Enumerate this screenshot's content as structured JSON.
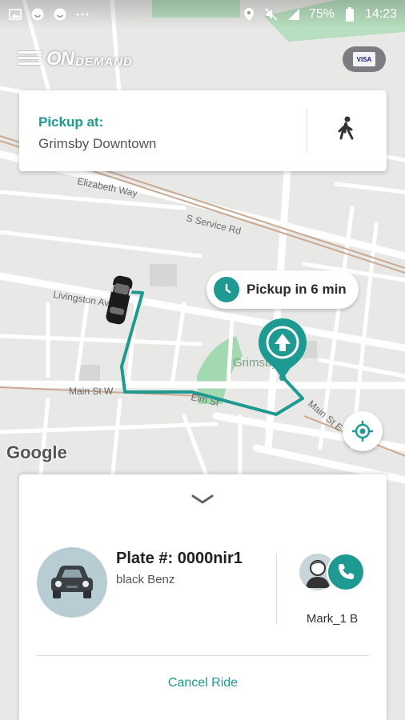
{
  "status_bar": {
    "battery": "75%",
    "time": "14:23",
    "icons": [
      "image-icon",
      "smiley-icon",
      "smiley-icon",
      "more-dots-icon",
      "location-icon",
      "mute-icon",
      "signal-icon",
      "battery-icon"
    ]
  },
  "header": {
    "logo_prefix": "ON",
    "logo_suffix": "DEMAND",
    "payment_card": "VISA"
  },
  "pickup": {
    "label": "Pickup at:",
    "value": "Grimsby Downtown"
  },
  "map": {
    "eta_text": "Pickup in 6 min",
    "street_labels": {
      "main_st_w": "Main St W",
      "elm_st": "Elm St",
      "main_st": "Main St E",
      "elizabeth_way": "Elizabeth Way",
      "service_rd": "S Service Rd",
      "livingston": "Livingston Ave",
      "grimsby": "Grimsby"
    },
    "attribution": "Google"
  },
  "ride": {
    "plate": "Plate #: 0000nir1",
    "car_description": "black Benz",
    "driver_name": "Mark_1 B",
    "cancel_label": "Cancel Ride"
  },
  "colors": {
    "accent": "#1f9a92",
    "route": "#1f9a92",
    "park": "#a3d9b1"
  }
}
